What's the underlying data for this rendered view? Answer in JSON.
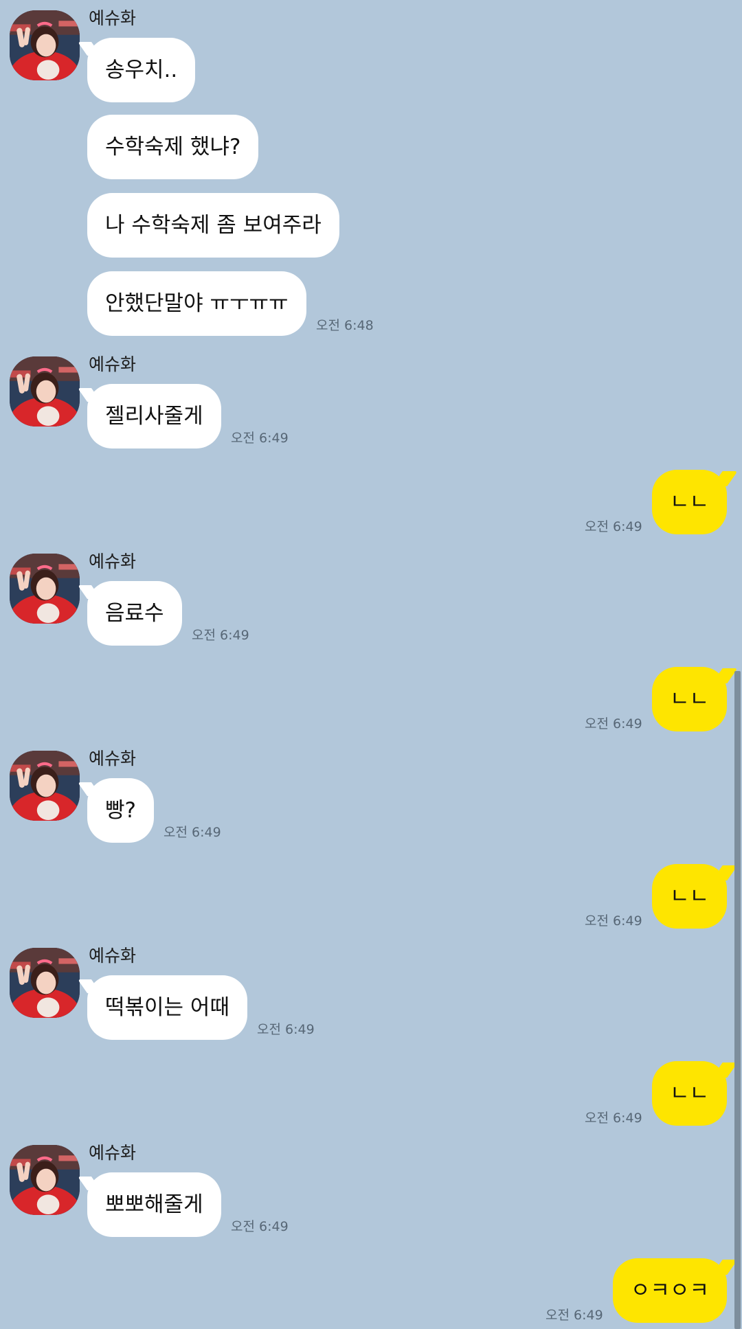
{
  "sender_name": "예슈화",
  "messages": [
    {
      "dir": "in",
      "text": "송우치..",
      "show_sender": true,
      "time": ""
    },
    {
      "dir": "in",
      "text": "수학숙제 했냐?",
      "show_sender": false,
      "time": ""
    },
    {
      "dir": "in",
      "text": "나 수학숙제 좀 보여주라",
      "show_sender": false,
      "time": ""
    },
    {
      "dir": "in",
      "text": "안했단말야 ㅠㅜㅠㅠ",
      "show_sender": false,
      "time": "오전 6:48"
    },
    {
      "dir": "in",
      "text": "젤리사줄게",
      "show_sender": true,
      "time": "오전 6:49"
    },
    {
      "dir": "out",
      "text": "ㄴㄴ",
      "time": "오전 6:49"
    },
    {
      "dir": "in",
      "text": "음료수",
      "show_sender": true,
      "time": "오전 6:49"
    },
    {
      "dir": "out",
      "text": "ㄴㄴ",
      "time": "오전 6:49"
    },
    {
      "dir": "in",
      "text": "빵?",
      "show_sender": true,
      "time": "오전 6:49"
    },
    {
      "dir": "out",
      "text": "ㄴㄴ",
      "time": "오전 6:49"
    },
    {
      "dir": "in",
      "text": "떡볶이는 어때",
      "show_sender": true,
      "time": "오전 6:49"
    },
    {
      "dir": "out",
      "text": "ㄴㄴ",
      "time": "오전 6:49"
    },
    {
      "dir": "in",
      "text": "뽀뽀해줄게",
      "show_sender": true,
      "time": "오전 6:49"
    },
    {
      "dir": "out",
      "text": "ㅇㅋㅇㅋ",
      "time": "오전 6:49"
    }
  ],
  "colors": {
    "background": "#b2c7da",
    "incoming_bubble": "#ffffff",
    "outgoing_bubble": "#fee500",
    "timestamp": "#576776"
  },
  "icons": {
    "avatar": "profile-photo"
  }
}
